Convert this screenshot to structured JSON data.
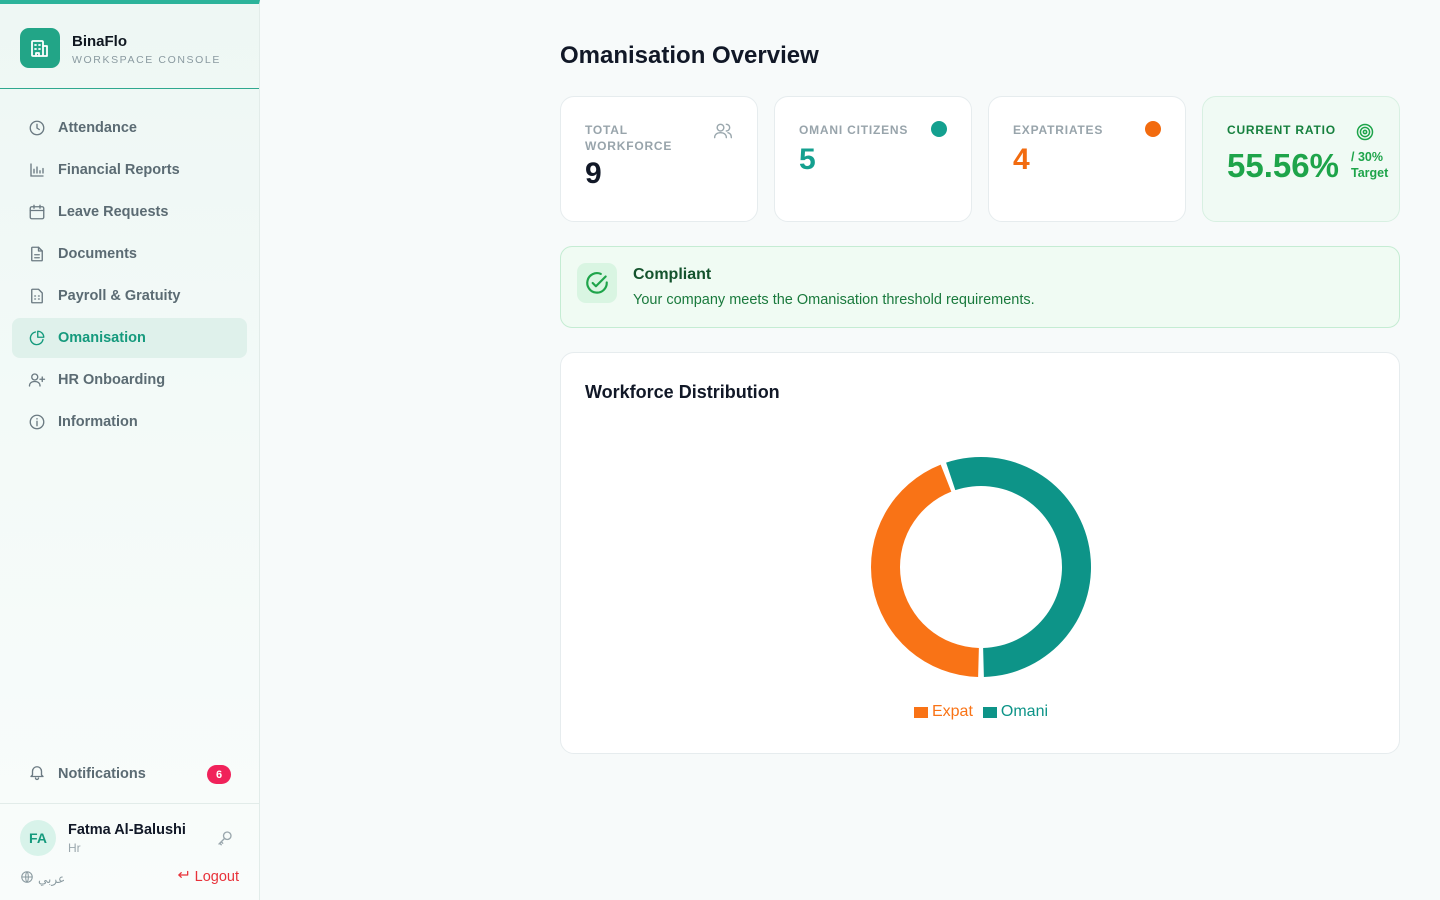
{
  "brand": {
    "name": "BinaFlo",
    "subtitle": "WORKSPACE CONSOLE",
    "logo_icon": "building-icon",
    "color": "#22a587"
  },
  "sidebar": {
    "items": [
      {
        "label": "Attendance",
        "icon": "clock-icon",
        "active": false
      },
      {
        "label": "Financial Reports",
        "icon": "bar-chart-icon",
        "active": false
      },
      {
        "label": "Leave Requests",
        "icon": "calendar-icon",
        "active": false
      },
      {
        "label": "Documents",
        "icon": "document-icon",
        "active": false
      },
      {
        "label": "Payroll & Gratuity",
        "icon": "calculator-icon",
        "active": false
      },
      {
        "label": "Omanisation",
        "icon": "pie-chart-icon",
        "active": true
      },
      {
        "label": "HR Onboarding",
        "icon": "user-plus-icon",
        "active": false
      },
      {
        "label": "Information",
        "icon": "info-icon",
        "active": false
      }
    ],
    "notifications": {
      "label": "Notifications",
      "count": "6",
      "icon": "bell-icon"
    }
  },
  "user": {
    "initials": "FA",
    "name": "Fatma Al-Balushi",
    "role": "Hr",
    "language": "عربي",
    "logout_label": "Logout"
  },
  "page": {
    "title": "Omanisation Overview"
  },
  "stats": {
    "total": {
      "label": "TOTAL WORKFORCE",
      "value": "9",
      "icon": "users-icon"
    },
    "omani": {
      "label": "OMANI CITIZENS",
      "value": "5",
      "color": "#14a08f"
    },
    "expat": {
      "label": "EXPATRIATES",
      "value": "4",
      "color": "#f26b0f"
    },
    "ratio": {
      "label": "CURRENT RATIO",
      "value": "55.56%",
      "target_line1": "/ 30%",
      "target_line2": "Target",
      "icon": "target-icon"
    }
  },
  "compliance": {
    "title": "Compliant",
    "message": "Your company meets the Omanisation threshold requirements.",
    "icon": "check-circle-icon"
  },
  "chart_data": {
    "type": "pie",
    "title": "Workforce Distribution",
    "labels": [
      "Expat",
      "Omani"
    ],
    "values": [
      4,
      5
    ],
    "colors": [
      "#f97316",
      "#0d9488"
    ],
    "legend": "bottom"
  }
}
